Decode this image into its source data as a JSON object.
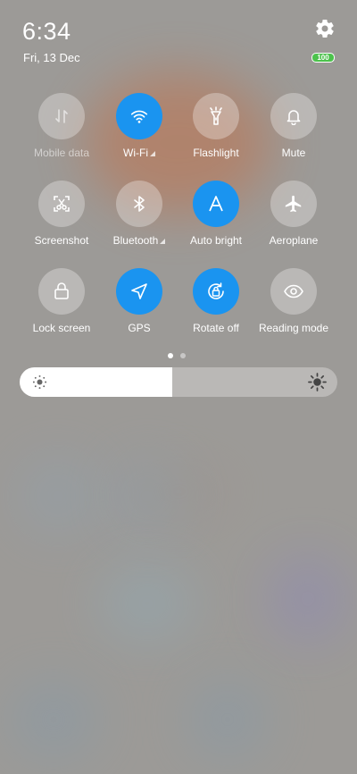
{
  "status": {
    "time": "6:34",
    "date": "Fri, 13 Dec",
    "battery": "100"
  },
  "tiles": [
    {
      "label": "Mobile data",
      "state": "off",
      "icon": "mobile-data-icon"
    },
    {
      "label": "Wi-Fi",
      "state": "on",
      "icon": "wifi-icon"
    },
    {
      "label": "Flashlight",
      "state": "off",
      "icon": "flashlight-icon"
    },
    {
      "label": "Mute",
      "state": "off",
      "icon": "bell-icon"
    },
    {
      "label": "Screenshot",
      "state": "off",
      "icon": "screenshot-icon"
    },
    {
      "label": "Bluetooth",
      "state": "off",
      "icon": "bluetooth-icon"
    },
    {
      "label": "Auto bright",
      "state": "on",
      "icon": "auto-brightness-icon"
    },
    {
      "label": "Aeroplane",
      "state": "off",
      "icon": "airplane-icon"
    },
    {
      "label": "Lock screen",
      "state": "off",
      "icon": "lock-icon"
    },
    {
      "label": "GPS",
      "state": "on",
      "icon": "gps-icon"
    },
    {
      "label": "Rotate off",
      "state": "on",
      "icon": "rotate-lock-icon"
    },
    {
      "label": "Reading mode",
      "state": "off",
      "icon": "eye-icon"
    }
  ],
  "pager": {
    "page": 1,
    "total": 2
  },
  "brightness": {
    "level": 0.48
  },
  "colors": {
    "accent": "#1a94f0",
    "battery": "#4cc24c"
  }
}
